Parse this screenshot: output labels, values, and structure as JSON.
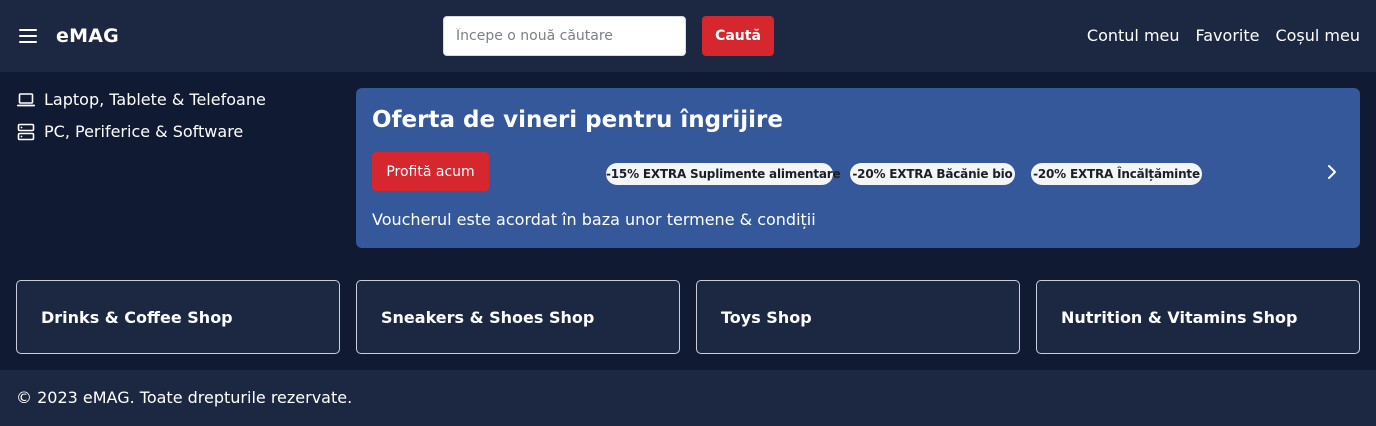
{
  "header": {
    "logo": "eMAG",
    "search_placeholder": "Începe o nouă căutare",
    "search_button": "Caută",
    "nav": [
      "Contul meu",
      "Favorite",
      "Coșul meu"
    ]
  },
  "sidebar": {
    "items": [
      {
        "label": "Laptop, Tablete & Telefoane",
        "icon": "laptop-icon"
      },
      {
        "label": "PC, Periferice & Software",
        "icon": "server-icon"
      }
    ]
  },
  "banner": {
    "title": "Oferta de vineri pentru îngrijire",
    "cta": "Profită acum",
    "chips": [
      "-15% EXTRA Suplimente alimentare",
      "-20% EXTRA Băcănie bio",
      "-20% EXTRA Încălțăminte"
    ],
    "note": "Voucherul este acordat în baza unor termene & condiții",
    "next_icon": "chevron-right-icon"
  },
  "shops": [
    "Drinks & Coffee Shop",
    "Sneakers & Shoes Shop",
    "Toys Shop",
    "Nutrition & Vitamins Shop"
  ],
  "footer": {
    "text": "© 2023 eMAG. Toate drepturile rezervate."
  },
  "colors": {
    "page_bg": "#111a33",
    "header_bg": "#1c2841",
    "banner_bg": "#34589a",
    "accent_red": "#d6262e"
  }
}
